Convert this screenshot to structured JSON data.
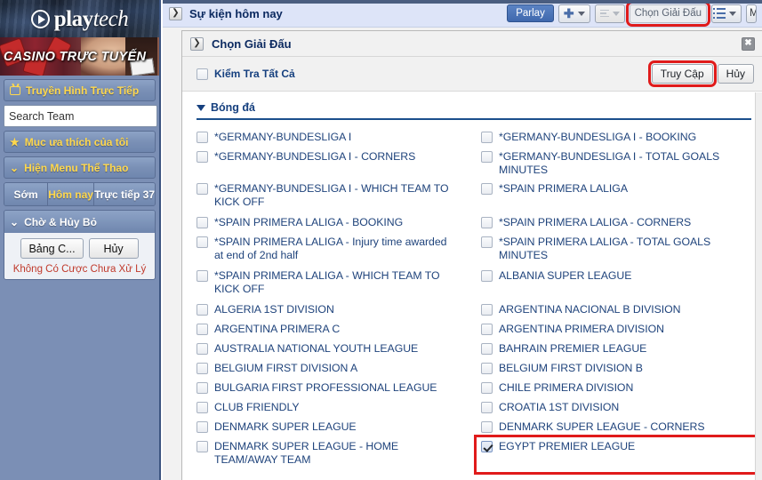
{
  "sidebar": {
    "logo": {
      "brand": "play",
      "brand_italic": "tech",
      "mark_icon": "play-circle-icon"
    },
    "casino_banner": {
      "text": "CASINO TRỰC TUYẾN"
    },
    "live_tv_button": {
      "label": "Truyền Hình Trực Tiếp",
      "icon": "tv-icon"
    },
    "search": {
      "value": "",
      "placeholder": "Search Team",
      "button_icon": "search-icon"
    },
    "favorites_button": {
      "label": "Mục ưa thích của tôi",
      "icon": "star-icon"
    },
    "sports_menu_button": {
      "label": "Hiện Menu Thể Thao",
      "icon": "chevron-down-icon"
    },
    "segments": [
      {
        "label": "Sớm",
        "active": false
      },
      {
        "label": "Hôm nay",
        "active": true
      },
      {
        "label": "Trực tiếp 37",
        "active": false
      }
    ],
    "pending_panel": {
      "title": "Chờ & Hủy Bỏ",
      "icon": "chevron-down-icon",
      "buttons": [
        "Bảng C...",
        "Hủy"
      ],
      "note": "Không Có Cược Chưa Xử Lý"
    }
  },
  "topbar": {
    "expand_icon": "chevron-right-icon",
    "title": "Sự kiện hôm nay",
    "parlay_label": "Parlay",
    "add_button": {
      "icon": "plus-icon",
      "caret": "chevron-down-icon"
    },
    "sort_button": {
      "icon": "sort-lines-icon",
      "caret": "chevron-down-icon"
    },
    "select_league_label": "Chọn Giải Đấu",
    "list_button": {
      "icon": "list-bullets-icon",
      "caret": "chevron-down-icon"
    },
    "overflow_button_label": "M"
  },
  "dialog": {
    "expand_icon": "chevron-right-icon",
    "title": "Chọn Giải Đấu",
    "close_icon": "close-icon",
    "check_all": {
      "label": "Kiểm Tra Tất Cả",
      "checked": false
    },
    "submit_label": "Truy Cập",
    "cancel_label": "Hủy",
    "sport_section": {
      "label": "Bóng đá",
      "icon": "triangle-down-icon",
      "expanded": true
    },
    "leagues": [
      {
        "label": "*GERMANY-BUNDESLIGA I",
        "checked": false,
        "col": "left"
      },
      {
        "label": "*GERMANY-BUNDESLIGA I - BOOKING",
        "checked": false,
        "col": "right"
      },
      {
        "label": "*GERMANY-BUNDESLIGA I - CORNERS",
        "checked": false,
        "col": "left"
      },
      {
        "label": "*GERMANY-BUNDESLIGA I - TOTAL GOALS MINUTES",
        "checked": false,
        "col": "right"
      },
      {
        "label": "*GERMANY-BUNDESLIGA I - WHICH TEAM TO KICK OFF",
        "checked": false,
        "col": "left",
        "tall": true
      },
      {
        "label": "*SPAIN PRIMERA LALIGA",
        "checked": false,
        "col": "right"
      },
      {
        "label": "*SPAIN PRIMERA LALIGA - BOOKING",
        "checked": false,
        "col": "left"
      },
      {
        "label": "*SPAIN PRIMERA LALIGA - CORNERS",
        "checked": false,
        "col": "right"
      },
      {
        "label": "*SPAIN PRIMERA LALIGA - Injury time awarded at end of 2nd half",
        "checked": false,
        "col": "left",
        "tall": true
      },
      {
        "label": "*SPAIN PRIMERA LALIGA - TOTAL GOALS MINUTES",
        "checked": false,
        "col": "right"
      },
      {
        "label": "*SPAIN PRIMERA LALIGA - WHICH TEAM TO KICK OFF",
        "checked": false,
        "col": "left",
        "tall": true
      },
      {
        "label": "ALBANIA SUPER LEAGUE",
        "checked": false,
        "col": "right"
      },
      {
        "label": "ALGERIA 1ST DIVISION",
        "checked": false,
        "col": "left"
      },
      {
        "label": "ARGENTINA NACIONAL B DIVISION",
        "checked": false,
        "col": "right"
      },
      {
        "label": "ARGENTINA PRIMERA C",
        "checked": false,
        "col": "left"
      },
      {
        "label": "ARGENTINA PRIMERA DIVISION",
        "checked": false,
        "col": "right"
      },
      {
        "label": "AUSTRALIA NATIONAL YOUTH LEAGUE",
        "checked": false,
        "col": "left"
      },
      {
        "label": "BAHRAIN PREMIER LEAGUE",
        "checked": false,
        "col": "right"
      },
      {
        "label": "BELGIUM FIRST DIVISION A",
        "checked": false,
        "col": "left"
      },
      {
        "label": "BELGIUM FIRST DIVISION B",
        "checked": false,
        "col": "right"
      },
      {
        "label": "BULGARIA FIRST PROFESSIONAL LEAGUE",
        "checked": false,
        "col": "left"
      },
      {
        "label": "CHILE PRIMERA DIVISION",
        "checked": false,
        "col": "right"
      },
      {
        "label": "CLUB FRIENDLY",
        "checked": false,
        "col": "left"
      },
      {
        "label": "CROATIA 1ST DIVISION",
        "checked": false,
        "col": "right"
      },
      {
        "label": "DENMARK SUPER LEAGUE",
        "checked": false,
        "col": "left"
      },
      {
        "label": "DENMARK SUPER LEAGUE - CORNERS",
        "checked": false,
        "col": "right"
      },
      {
        "label": "DENMARK SUPER LEAGUE - HOME TEAM/AWAY TEAM",
        "checked": false,
        "col": "left",
        "tall": true
      },
      {
        "label": "EGYPT PREMIER LEAGUE",
        "checked": true,
        "col": "right",
        "highlighted": true
      }
    ]
  },
  "colors": {
    "sidebar_bg": "#7b8fb5",
    "sidebar_accent": "#ffd84d",
    "topbar_bg": "#dde4f8",
    "title_blue": "#0c2a60",
    "league_text": "#20447c",
    "highlight_red": "#e01b1b",
    "parlay_blue": "#3f68ad",
    "note_red": "#c0392b"
  }
}
